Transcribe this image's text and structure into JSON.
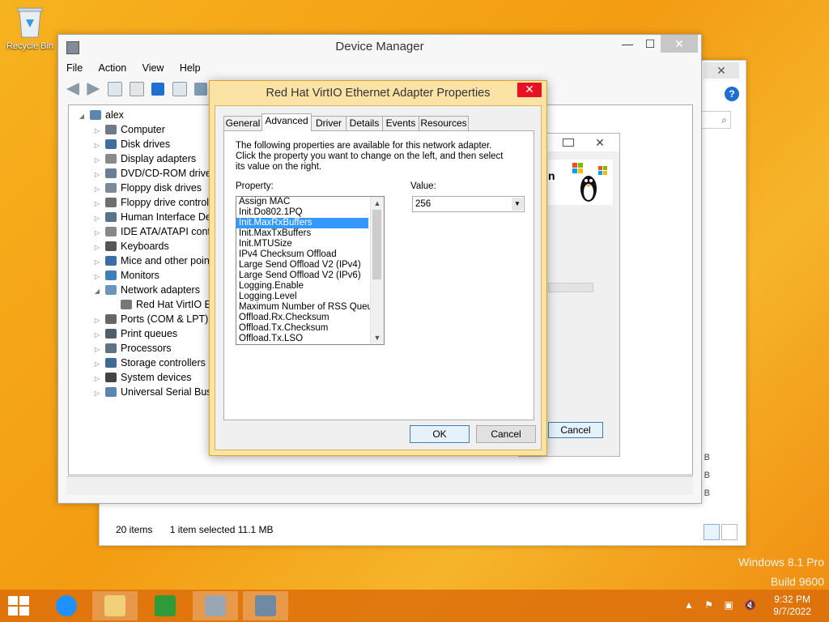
{
  "desktop": {
    "recycle_bin": "Recycle Bin",
    "watermark_line1": "Windows 8.1 Pro",
    "watermark_line2": "Build 9600"
  },
  "explorer": {
    "close": "✕",
    "search": "⌕",
    "status_items": "20 items",
    "status_selected": "1 item selected  11.1 MB",
    "size_labels": [
      "B",
      "B",
      "B",
      "B"
    ]
  },
  "props_window_behind": {
    "title_fragment": "n",
    "cancel": "Cancel",
    "close": "✕"
  },
  "device_manager": {
    "title": "Device Manager",
    "menu": [
      "File",
      "Action",
      "View",
      "Help"
    ],
    "tree": [
      {
        "label": "alex",
        "level": 0,
        "expanded": true,
        "icon": "computer-icon"
      },
      {
        "label": "Computer",
        "level": 1,
        "icon": "computer-icon"
      },
      {
        "label": "Disk drives",
        "level": 1,
        "icon": "disk-drive-icon"
      },
      {
        "label": "Display adapters",
        "level": 1,
        "icon": "display-adapter-icon"
      },
      {
        "label": "DVD/CD-ROM drives",
        "level": 1,
        "icon": "dvd-icon"
      },
      {
        "label": "Floppy disk drives",
        "level": 1,
        "icon": "floppy-icon"
      },
      {
        "label": "Floppy drive controll",
        "level": 1,
        "icon": "floppy-controller-icon"
      },
      {
        "label": "Human Interface Dev",
        "level": 1,
        "icon": "hid-icon"
      },
      {
        "label": "IDE ATA/ATAPI contr",
        "level": 1,
        "icon": "ide-icon"
      },
      {
        "label": "Keyboards",
        "level": 1,
        "icon": "keyboard-icon"
      },
      {
        "label": "Mice and other point",
        "level": 1,
        "icon": "mouse-icon"
      },
      {
        "label": "Monitors",
        "level": 1,
        "icon": "monitor-icon"
      },
      {
        "label": "Network adapters",
        "level": 1,
        "expanded": true,
        "icon": "network-adapter-icon"
      },
      {
        "label": "Red Hat VirtIO Eth",
        "level": 2,
        "icon": "network-card-icon"
      },
      {
        "label": "Ports (COM & LPT)",
        "level": 1,
        "icon": "port-icon"
      },
      {
        "label": "Print queues",
        "level": 1,
        "icon": "printer-icon"
      },
      {
        "label": "Processors",
        "level": 1,
        "icon": "processor-icon"
      },
      {
        "label": "Storage controllers",
        "level": 1,
        "icon": "storage-controller-icon"
      },
      {
        "label": "System devices",
        "level": 1,
        "icon": "system-device-icon"
      },
      {
        "label": "Universal Serial Bus c",
        "level": 1,
        "icon": "usb-icon"
      }
    ]
  },
  "dialog": {
    "title": "Red Hat VirtIO Ethernet Adapter Properties",
    "tabs": [
      "General",
      "Advanced",
      "Driver",
      "Details",
      "Events",
      "Resources"
    ],
    "active_tab": "Advanced",
    "description": "The following properties are available for this network adapter. Click the property you want to change on the left, and then select its value on the right.",
    "property_label": "Property:",
    "value_label": "Value:",
    "properties": [
      "Assign MAC",
      "Init.Do802.1PQ",
      "Init.MaxRxBuffers",
      "Init.MaxTxBuffers",
      "Init.MTUSize",
      "IPv4 Checksum Offload",
      "Large Send Offload V2 (IPv4)",
      "Large Send Offload V2 (IPv6)",
      "Logging.Enable",
      "Logging.Level",
      "Maximum Number of RSS Queues",
      "Offload.Rx.Checksum",
      "Offload.Tx.Checksum",
      "Offload.Tx.LSO"
    ],
    "selected_property": "Init.MaxRxBuffers",
    "value": "256",
    "ok": "OK",
    "cancel": "Cancel",
    "close": "✕"
  },
  "taskbar": {
    "apps": [
      "internet-explorer-icon",
      "file-explorer-icon",
      "store-icon",
      "device-manager-icon",
      "network-settings-icon"
    ],
    "time": "9:32 PM",
    "date": "9/7/2022"
  },
  "colors": {
    "accent": "#f39c12",
    "selection": "#3399ff",
    "dialog_frame": "#fbe3a6",
    "close_red": "#e81123"
  }
}
